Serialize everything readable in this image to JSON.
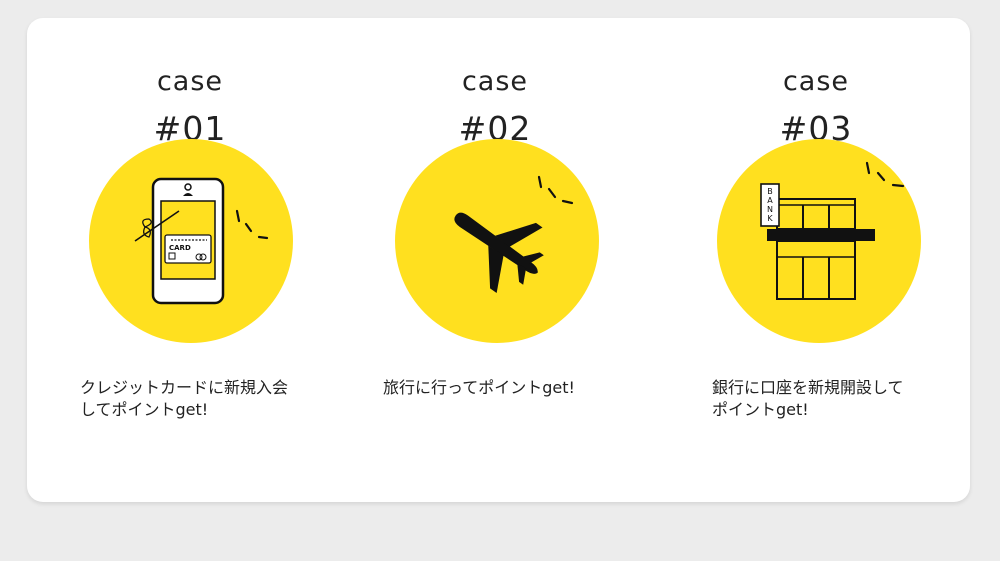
{
  "colors": {
    "background": "#ececec",
    "card": "#ffffff",
    "accent_yellow": "#ffe01f",
    "text": "#222222"
  },
  "cases": [
    {
      "word": "case",
      "number": "#01",
      "icon": "smartphone-card-icon",
      "card_label": "CARD",
      "lines": [
        "クレジットカードに新規入会",
        "してポイントget!"
      ]
    },
    {
      "word": "case",
      "number": "#02",
      "icon": "airplane-icon",
      "lines": [
        "旅行に行ってポイントget!"
      ]
    },
    {
      "word": "case",
      "number": "#03",
      "icon": "bank-building-icon",
      "sign_letters": [
        "B",
        "A",
        "N",
        "K"
      ],
      "lines": [
        "銀行に口座を新規開設して",
        "ポイントget!"
      ]
    }
  ]
}
